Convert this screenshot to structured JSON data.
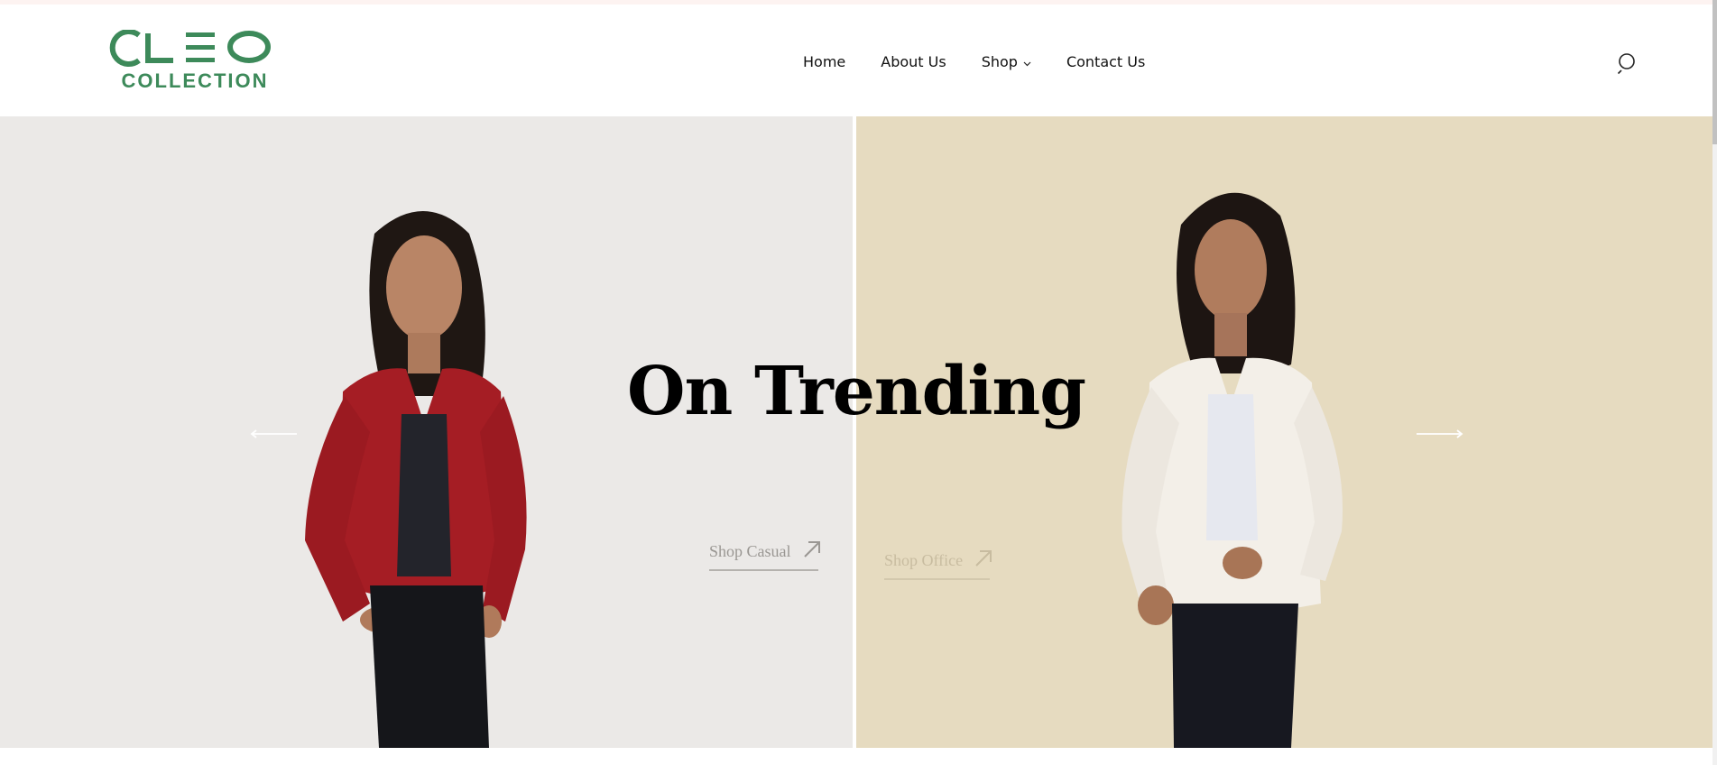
{
  "brand": {
    "logo_line1": "CL",
    "logo_line1_end": "O",
    "logo_line2": "COLLECTION",
    "color": "#3d8a5a"
  },
  "nav": {
    "items": [
      {
        "label": "Home"
      },
      {
        "label": "About Us"
      },
      {
        "label": "Shop",
        "has_dropdown": true,
        "icon": "chevron-down-icon"
      },
      {
        "label": "Contact Us"
      }
    ],
    "search_icon": "search-icon"
  },
  "hero": {
    "title": "On Trending",
    "prev_icon": "arrow-left-icon",
    "next_icon": "arrow-right-icon",
    "left_panel": {
      "background": "#ebe9e7",
      "cta_label": "Shop Casual",
      "cta_icon": "arrow-up-right-icon"
    },
    "right_panel": {
      "background": "#e6dbc0",
      "cta_label": "Shop Office",
      "cta_icon": "arrow-up-right-icon"
    }
  }
}
